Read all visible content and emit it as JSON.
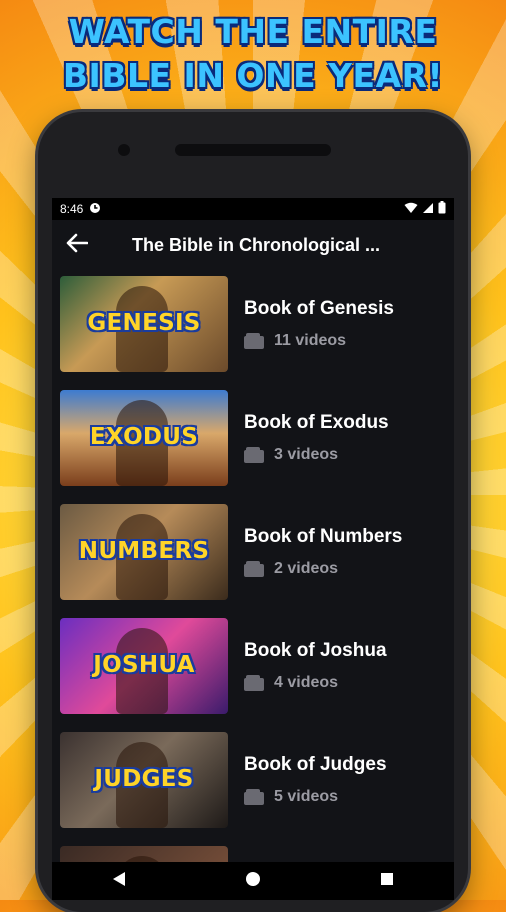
{
  "promo": {
    "line1": "WATCH THE ENTIRE",
    "line2": "BIBLE  IN ONE YEAR!"
  },
  "status": {
    "time": "8:46"
  },
  "appbar": {
    "title": "The Bible in Chronological ...",
    "back_icon": "arrow-left-icon"
  },
  "playlists": [
    {
      "thumb_label": "GENESIS",
      "title": "Book of Genesis",
      "count": "11 videos"
    },
    {
      "thumb_label": "EXODUS",
      "title": "Book of Exodus",
      "count": "3 videos"
    },
    {
      "thumb_label": "NUMBERS",
      "title": "Book of Numbers",
      "count": "2 videos"
    },
    {
      "thumb_label": "JOSHUA",
      "title": "Book of Joshua",
      "count": "4 videos"
    },
    {
      "thumb_label": "JUDGES",
      "title": "Book of Judges",
      "count": "5 videos"
    }
  ],
  "colors": {
    "promo_text": "#3cc3ff",
    "screen_bg": "#121317",
    "thumb_text": "#ffd428"
  }
}
